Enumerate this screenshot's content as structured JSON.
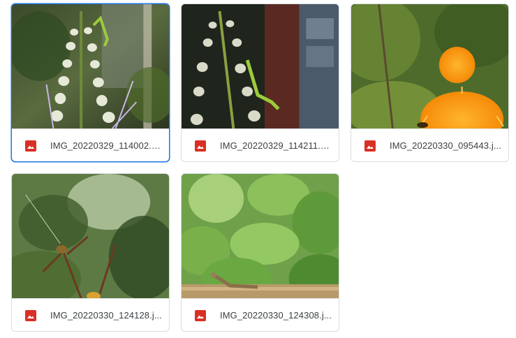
{
  "files": [
    {
      "name": "IMG_20220329_114002.J...",
      "icon": "image-file-icon",
      "selected": true
    },
    {
      "name": "IMG_20220329_114211.J...",
      "icon": "image-file-icon",
      "selected": false
    },
    {
      "name": "IMG_20220330_095443.j...",
      "icon": "image-file-icon",
      "selected": false
    },
    {
      "name": "IMG_20220330_124128.j...",
      "icon": "image-file-icon",
      "selected": false
    },
    {
      "name": "IMG_20220330_124308.j...",
      "icon": "image-file-icon",
      "selected": false
    }
  ],
  "colors": {
    "image_icon": "#d93025",
    "selected_border": "#1a73e8",
    "card_border": "#dadce0",
    "text": "#3c4043"
  }
}
